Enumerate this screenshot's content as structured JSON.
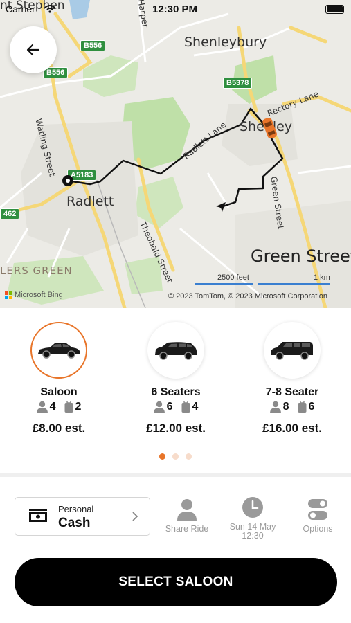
{
  "status_bar": {
    "carrier": "Carrier",
    "time": "12:30 PM"
  },
  "map": {
    "places": {
      "shenleybury": "Shenleybury",
      "shenley": "Shenley",
      "radlett": "Radlett",
      "green_street": "Green Street",
      "ellers_green": "LERS GREEN",
      "stephen_partial": "nt Stephen"
    },
    "roads": {
      "watling": "Watling Street",
      "radlett_lane": "Radlett Lane",
      "theobald": "Theobald Street",
      "green_street_road": "Green Street",
      "rectory": "Rectory Lane",
      "harper": "Harper"
    },
    "shields": {
      "b556_a": "B556",
      "b556_b": "B556",
      "b5378": "B5378",
      "a5183": "A5183",
      "b462": "462"
    },
    "scale": {
      "feet": "2500 feet",
      "km": "1 km"
    },
    "provider": "Microsoft Bing",
    "copyright": "© 2023 TomTom, © 2023 Microsoft Corporation"
  },
  "vehicles": [
    {
      "name": "Saloon",
      "passengers": "4",
      "luggage": "2",
      "price": "£8.00 est.",
      "selected": true,
      "icon": "saloon-car-icon"
    },
    {
      "name": "6 Seaters",
      "passengers": "6",
      "luggage": "4",
      "price": "£12.00 est.",
      "selected": false,
      "icon": "mpv-icon"
    },
    {
      "name": "7-8 Seater",
      "passengers": "8",
      "luggage": "6",
      "price": "£16.00 est.",
      "selected": false,
      "icon": "van-icon"
    }
  ],
  "pagination": {
    "pages": 3,
    "active": 0
  },
  "payment": {
    "label": "Personal",
    "method": "Cash"
  },
  "options": {
    "share_ride": "Share Ride",
    "date": "Sun 14 May",
    "time": "12:30",
    "options": "Options"
  },
  "cta": {
    "label": "SELECT SALOON"
  },
  "colors": {
    "accent": "#e8752a",
    "route": "#111111",
    "cta_bg": "#000000",
    "park_green": "#bfe0a8"
  }
}
